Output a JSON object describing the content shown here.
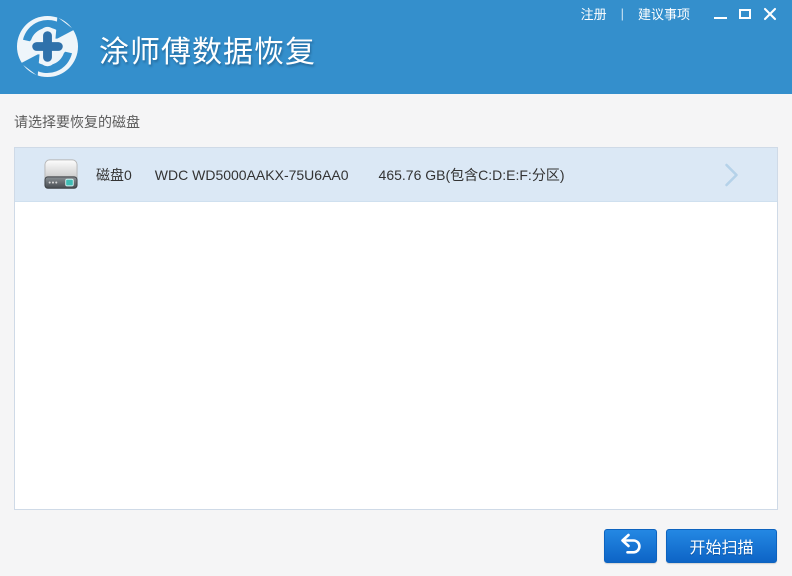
{
  "titlebar": {
    "register": "注册",
    "separator": "|",
    "suggestions": "建议事项",
    "controls": {
      "minimize_icon": "minimize-icon",
      "maximize_icon": "maximize-icon",
      "close_icon": "close-icon"
    }
  },
  "header": {
    "app_title": "涂师傅数据恢复",
    "logo_icon": "recovery-cycle-plus-icon"
  },
  "main": {
    "prompt": "请选择要恢复的磁盘",
    "disk_list": [
      {
        "icon": "hard-drive-icon",
        "name": "磁盘0",
        "model": "WDC WD5000AAKX-75U6AA0",
        "capacity": "465.76 GB(包含C:D:E:F:分区)",
        "chevron_icon": "chevron-right-icon"
      }
    ]
  },
  "footer": {
    "back_icon": "undo-arrow-icon",
    "scan_label": "开始扫描"
  },
  "colors": {
    "header_blue": "#348fcc",
    "button_blue_top": "#2488e3",
    "button_blue_bottom": "#0d64c6",
    "selected_row_bg": "#dbe8f5",
    "panel_border": "#cfdae7",
    "page_bg": "#f5f5f6",
    "chevron_blue": "#b5d2e9",
    "text_dark": "#333333",
    "prompt_gray": "#5b5b5b"
  }
}
